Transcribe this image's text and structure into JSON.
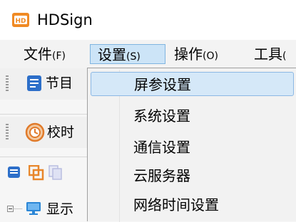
{
  "app": {
    "title": "HDSign",
    "icon": "hdsign-logo-icon"
  },
  "menubar": {
    "items": [
      {
        "label": "文件",
        "accel": "(F)"
      },
      {
        "label": "设置",
        "accel": "(S)"
      },
      {
        "label": "操作",
        "accel": "(O)"
      },
      {
        "label": "工具",
        "accel": "("
      }
    ],
    "active_index": 1
  },
  "toolbar": {
    "program_label": "节目",
    "time_label": "校时"
  },
  "tree": {
    "root_label": "显示"
  },
  "dropdown": {
    "items": [
      {
        "label": "屏参设置"
      },
      {
        "label": "系统设置"
      },
      {
        "label": "通信设置"
      },
      {
        "label": "云服务器"
      },
      {
        "label": "网络时间设置"
      }
    ],
    "highlighted_index": 0
  },
  "colors": {
    "menu_active_bg": "#cce4f7",
    "dropdown_highlight_bg": "#d5e8f8",
    "accent_blue": "#2d6fc9",
    "accent_orange": "#e8862b"
  }
}
